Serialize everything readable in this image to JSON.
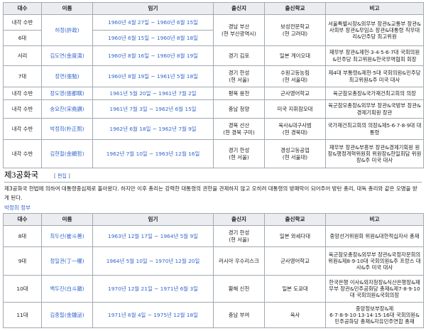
{
  "table1": {
    "headers": [
      "대수",
      "이름",
      "임기",
      "출신지",
      "출신학교",
      "비고"
    ],
    "rows": [
      {
        "era": "내각 수반",
        "name": "허정(許政)",
        "term": "1960년 4월 27일 ~ 1960년 6월 15일",
        "origin": "경남 부산\n(현 부산광역시)",
        "school": "보성전문학교\n(현 고려대)",
        "note": "서울특별시장&외무부 장관&교통부 장관&사회부 장관&무임소 장관&대통령 직무대리&민주당 최고위원"
      },
      {
        "era": "6대",
        "name": "",
        "term": "1960년 6월 15일 ~ 1960년 8월 18일",
        "origin": "",
        "school": "",
        "note": ""
      },
      {
        "era": "서리",
        "name": "김도연(金度演)",
        "term": "1960년 8월 16일 ~ 1960년 8월 19일",
        "origin": "경기 김포",
        "school": "일본 게이오대",
        "note": "재무부 장관&제헌·3·4·5·6·7대 국회의원&민주당 최고위원&한국무역협회 회장"
      },
      {
        "era": "7대",
        "name": "장면(張勉)",
        "term": "1960년 8월 19일 ~ 1961년 5월 18일",
        "origin": "경기 한성\n(현 서울)",
        "school": "수원고등농림\n(현 서울대)",
        "note": "제4대 부통령&제헌·5대 국회의원&민주당 최고위원&주 미국 대사"
      },
      {
        "era": "내각 수반",
        "name": "장도영(張都暎)",
        "term": "1961년 5월 20일 ~ 1961년 7월 2일",
        "origin": "평북 용천",
        "school": "군사영어학교",
        "note": "육군참모총장&국가재건최고회의 의장"
      },
      {
        "era": "내각 수반",
        "name": "송요찬(宋堯讚)",
        "term": "1961년 7월 3일 ~ 1962년 6월 15일",
        "origin": "충남 청양",
        "school": "미국 지휘참모대",
        "note": "육군참모총장&외무부 장관&국방부 장관&경제기획원 장관"
      },
      {
        "era": "내각 수반",
        "name": "박정희(朴正熙)",
        "term": "1962년 6월 18일 ~ 1962년 7월 9일",
        "origin": "경북 선산\n(현 경북 구미)",
        "school": "육사&대구사범\n(현 경북대)",
        "note": "국가재건최고회의 의장&제5·6·7·8·9대 대통령"
      },
      {
        "era": "내각 수반",
        "name": "김현철(金顯哲)",
        "term": "1962년 7월 10일 ~ 1963년 12월 16일",
        "origin": "경기 한성\n(현 서울)",
        "school": "경성고등공업\n(현 서울대)",
        "note": "재무부 장관&부흥부 장관&경제기획원 원장&행정개혁위원회 위원장&한일회담 위원장&주 미국 대사"
      }
    ]
  },
  "section": {
    "title": "제3공화국",
    "edit_label": "편집",
    "paragraph": "제3공화국 헌법에 의하여 대통령중심제로 돌아왔다. 하지만 이후 총리는 강력한 대통령의 권한을 견제하지 않고 오히려 대통령의 방패막이 되어주어 방탄 총리, 대독 총리와 같은 오명을 받게 된다.",
    "main_article_link": "박정희 정부"
  },
  "table2": {
    "headers": [
      "대수",
      "이름",
      "임기",
      "출신지",
      "출신학교",
      "비고"
    ],
    "rows": [
      {
        "era": "8대",
        "name": "최두선(崔斗善)",
        "term": "1963년 12월 17일 ~ 1964년 5월 9일",
        "origin": "경기 한성\n(현 서울)",
        "school": "일본 와세다대",
        "note": "중앙선거위원회 위원&대한적십자사 총재"
      },
      {
        "era": "9대",
        "name": "정일권(丁一權)",
        "term": "1964년 5월 10일 ~ 1970년 12월 20일",
        "origin": "러시아 우수리스크",
        "school": "군사영어학교",
        "note": "육군참모총장&외무부 장관&국정자문회의 위원&제8·9·10대 국회의원&주 프랑스 대사&주 미국 대사"
      },
      {
        "era": "10대",
        "name": "백두진(白斗鎭)",
        "term": "1970년 12월 21일 ~ 1971년 6월 3일",
        "origin": "황해 신천",
        "school": "일본 도쿄대",
        "note": "한국은행 이사&외자청장&식산은행장&재무부 장관&민주공화당 총재&제7·8·9·10대 국회의원&국회의장"
      },
      {
        "era": "11대",
        "name": "김종필(金鍾泌)",
        "term": "1971년 6월 4일 ~ 1975년 12월 18일",
        "origin": "충남 부여",
        "school": "육사",
        "note": "중앙정보부장&제6·7·8·9·10·13·14·15·16대 국회의원&민주공화당 총재&자유민주연합 총재"
      }
    ]
  },
  "colors": {
    "link": "#3366cc",
    "header_bg": "#eaecf0",
    "border": "#a2a9b1",
    "text": "#202122"
  }
}
